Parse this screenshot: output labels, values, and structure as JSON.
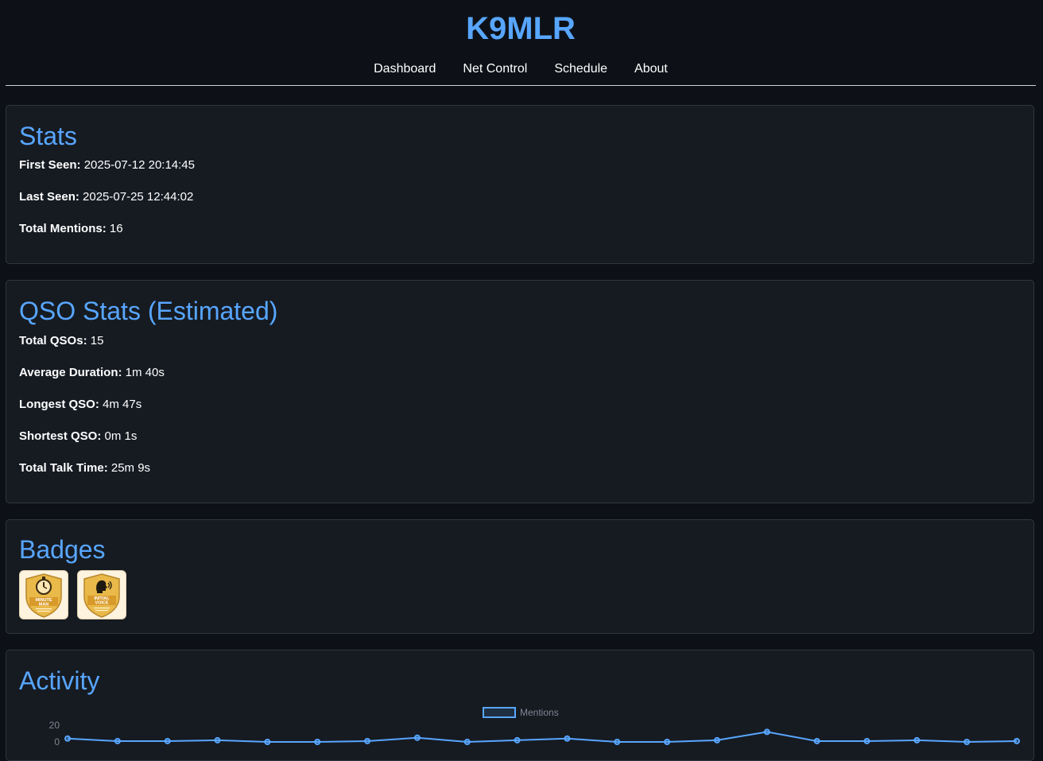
{
  "header": {
    "title": "K9MLR",
    "nav": [
      "Dashboard",
      "Net Control",
      "Schedule",
      "About"
    ]
  },
  "stats": {
    "heading": "Stats",
    "first_seen_label": "First Seen:",
    "first_seen_value": "2025-07-12 20:14:45",
    "last_seen_label": "Last Seen:",
    "last_seen_value": "2025-07-25 12:44:02",
    "total_mentions_label": "Total Mentions:",
    "total_mentions_value": "16"
  },
  "qso": {
    "heading": "QSO Stats (Estimated)",
    "total_label": "Total QSOs:",
    "total_value": "15",
    "avg_label": "Average Duration:",
    "avg_value": "1m 40s",
    "longest_label": "Longest QSO:",
    "longest_value": "4m 47s",
    "shortest_label": "Shortest QSO:",
    "shortest_value": "0m 1s",
    "talk_label": "Total Talk Time:",
    "talk_value": "25m 9s"
  },
  "badges": {
    "heading": "Badges",
    "items": [
      {
        "icon": "stopwatch-icon",
        "line1": "MINUTE",
        "line2": "MAN"
      },
      {
        "icon": "speaking-head-icon",
        "line1": "INITIAL",
        "line2": "VOICE"
      }
    ]
  },
  "activity": {
    "heading": "Activity"
  },
  "colors": {
    "accent": "#58a6ff",
    "background": "#0d1117",
    "card": "#161b22",
    "badge_gold": "#e9b949"
  },
  "chart_data": {
    "type": "line",
    "series": [
      {
        "name": "Mentions",
        "values": [
          4,
          1,
          1,
          2,
          0,
          0,
          1,
          5,
          0,
          2,
          4,
          0,
          0,
          2,
          12,
          1,
          1,
          2,
          0,
          1
        ]
      }
    ],
    "ylim": [
      0,
      20
    ],
    "y_ticks": [
      "0",
      "20"
    ],
    "legend": "top-center"
  }
}
